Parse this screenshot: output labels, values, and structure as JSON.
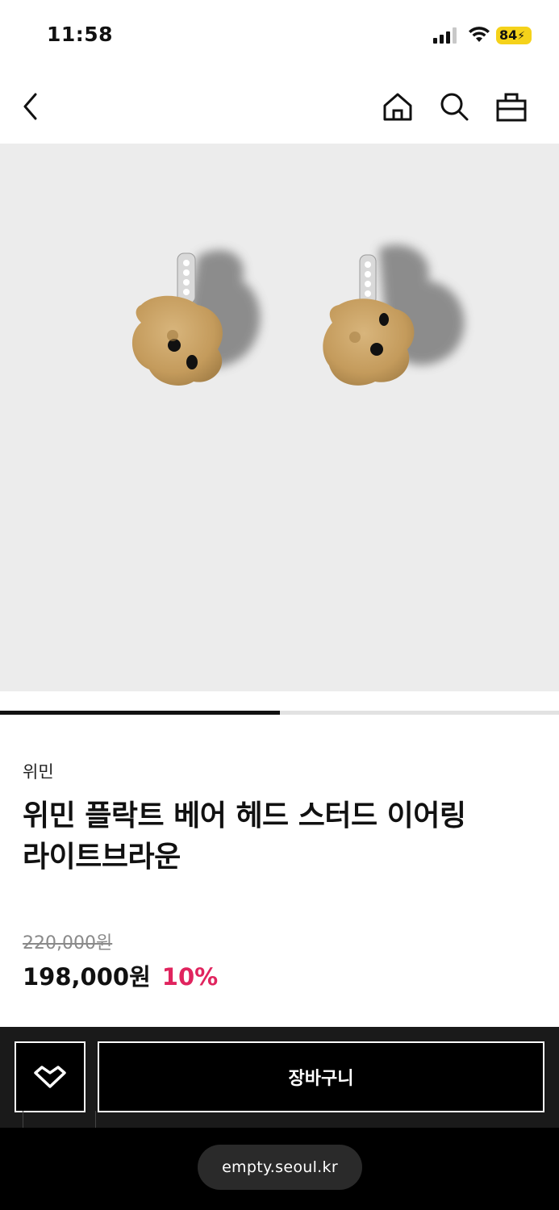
{
  "status_bar": {
    "time": "11:58",
    "battery": "84"
  },
  "nav": {
    "back_icon": "chevron-left-icon",
    "home_icon": "home-icon",
    "search_icon": "search-icon",
    "cart_icon": "shopping-bag-icon"
  },
  "product": {
    "image_alt": "Flocked bear head stud earrings",
    "brand": "위민",
    "title_line1": "위민 플락트 베어 헤드 스터드 이어링",
    "title_line2": "라이트브라운",
    "original_price": "220,000원",
    "sale_price": "198,000원",
    "discount": "10%",
    "carousel_progress": 0.5
  },
  "actions": {
    "wishlist_icon": "heart-chevron-icon",
    "cart_label": "장바구니"
  },
  "browser": {
    "url": "empty.seoul.kr"
  },
  "colors": {
    "discount": "#e0245e",
    "image_bg": "#ececec",
    "action_bg": "#1a1a1a"
  }
}
